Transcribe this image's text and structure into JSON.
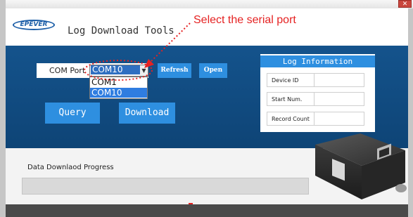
{
  "window": {
    "close_glyph": "✕",
    "title": "Log Download Tools",
    "brand": "EPEVER"
  },
  "annotation": {
    "text": "Select the serial port",
    "color": "#e52222"
  },
  "port": {
    "label": "COM Port",
    "selected": "COM10",
    "options": [
      "COM1",
      "COM10"
    ]
  },
  "buttons": {
    "refresh": "Refresh",
    "open": "Open",
    "query": "Query",
    "download": "Download"
  },
  "log_info": {
    "title": "Log Information",
    "fields": [
      "Device ID",
      "Start Num.",
      "Record Count"
    ]
  },
  "progress": {
    "label": "Data Downlaod Progress",
    "value": 0
  },
  "colors": {
    "panel_blue": "#14538c",
    "button_blue": "#2e8fe0",
    "highlight": "#2f7de0"
  }
}
